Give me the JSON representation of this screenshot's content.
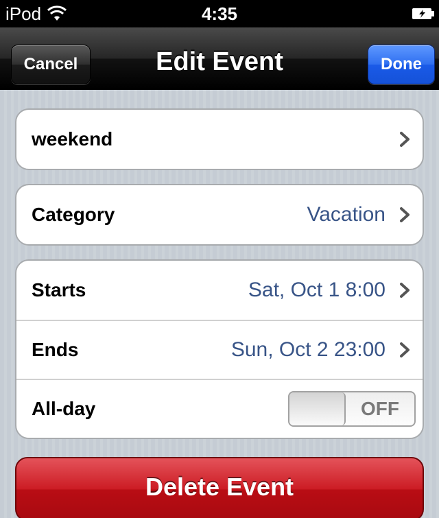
{
  "status_bar": {
    "carrier": "iPod",
    "time": "4:35",
    "wifi_icon": "wifi-icon",
    "battery_icon": "battery-charging-icon"
  },
  "nav_bar": {
    "title": "Edit Event",
    "cancel_label": "Cancel",
    "done_label": "Done",
    "done_color": "#2f6ff0"
  },
  "event": {
    "title": "weekend"
  },
  "category": {
    "label": "Category",
    "value": "Vacation"
  },
  "schedule": {
    "starts_label": "Starts",
    "starts_value": "Sat, Oct 1 8:00",
    "ends_label": "Ends",
    "ends_value": "Sun, Oct 2 23:00",
    "allday_label": "All-day",
    "allday_toggle": "OFF"
  },
  "delete_label": "Delete Event",
  "colors": {
    "value_text": "#385487",
    "delete_button": "#cc1c24",
    "background": "#c5ccd4"
  }
}
